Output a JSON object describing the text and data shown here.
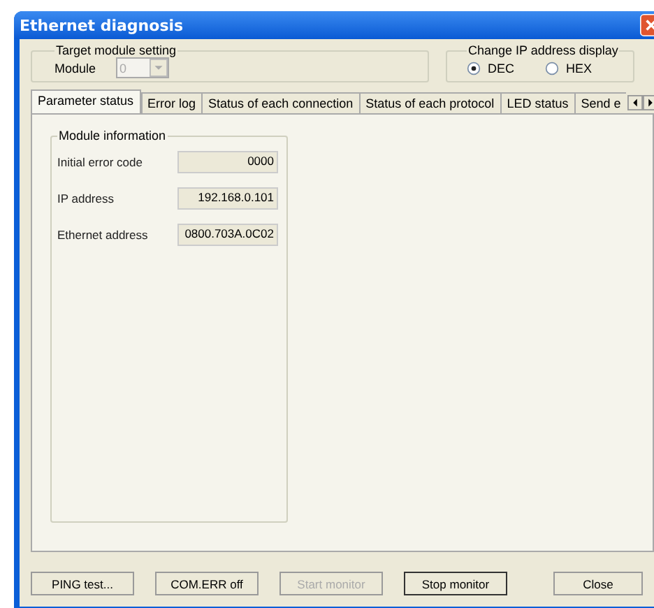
{
  "window": {
    "title": "Ethernet diagnosis"
  },
  "target_module_setting": {
    "title": "Target module setting",
    "label": "Module",
    "value": "0",
    "disabled": true
  },
  "ip_display": {
    "title": "Change IP address display",
    "options": [
      {
        "label": "DEC",
        "selected": true
      },
      {
        "label": "HEX",
        "selected": false
      }
    ]
  },
  "tabs": [
    {
      "label": "Parameter status",
      "selected": true
    },
    {
      "label": "Error log",
      "selected": false
    },
    {
      "label": "Status of each connection",
      "selected": false
    },
    {
      "label": "Status of each protocol",
      "selected": false
    },
    {
      "label": "LED status",
      "selected": false
    },
    {
      "label": "Send e",
      "selected": false
    }
  ],
  "module_information": {
    "title": "Module information",
    "fields": [
      {
        "label": "Initial error code",
        "value": "0000"
      },
      {
        "label": "IP address",
        "value": "192.168.0.101"
      },
      {
        "label": "Ethernet address",
        "value": "0800.703A.0C02"
      }
    ]
  },
  "buttons": [
    {
      "label": "PING test...",
      "disabled": false,
      "default": false
    },
    {
      "label": "COM.ERR off",
      "disabled": false,
      "default": false
    },
    {
      "label": "Start monitor",
      "disabled": true,
      "default": false
    },
    {
      "label": "Stop monitor",
      "disabled": false,
      "default": true
    },
    {
      "label": "Close",
      "disabled": false,
      "default": false
    }
  ]
}
